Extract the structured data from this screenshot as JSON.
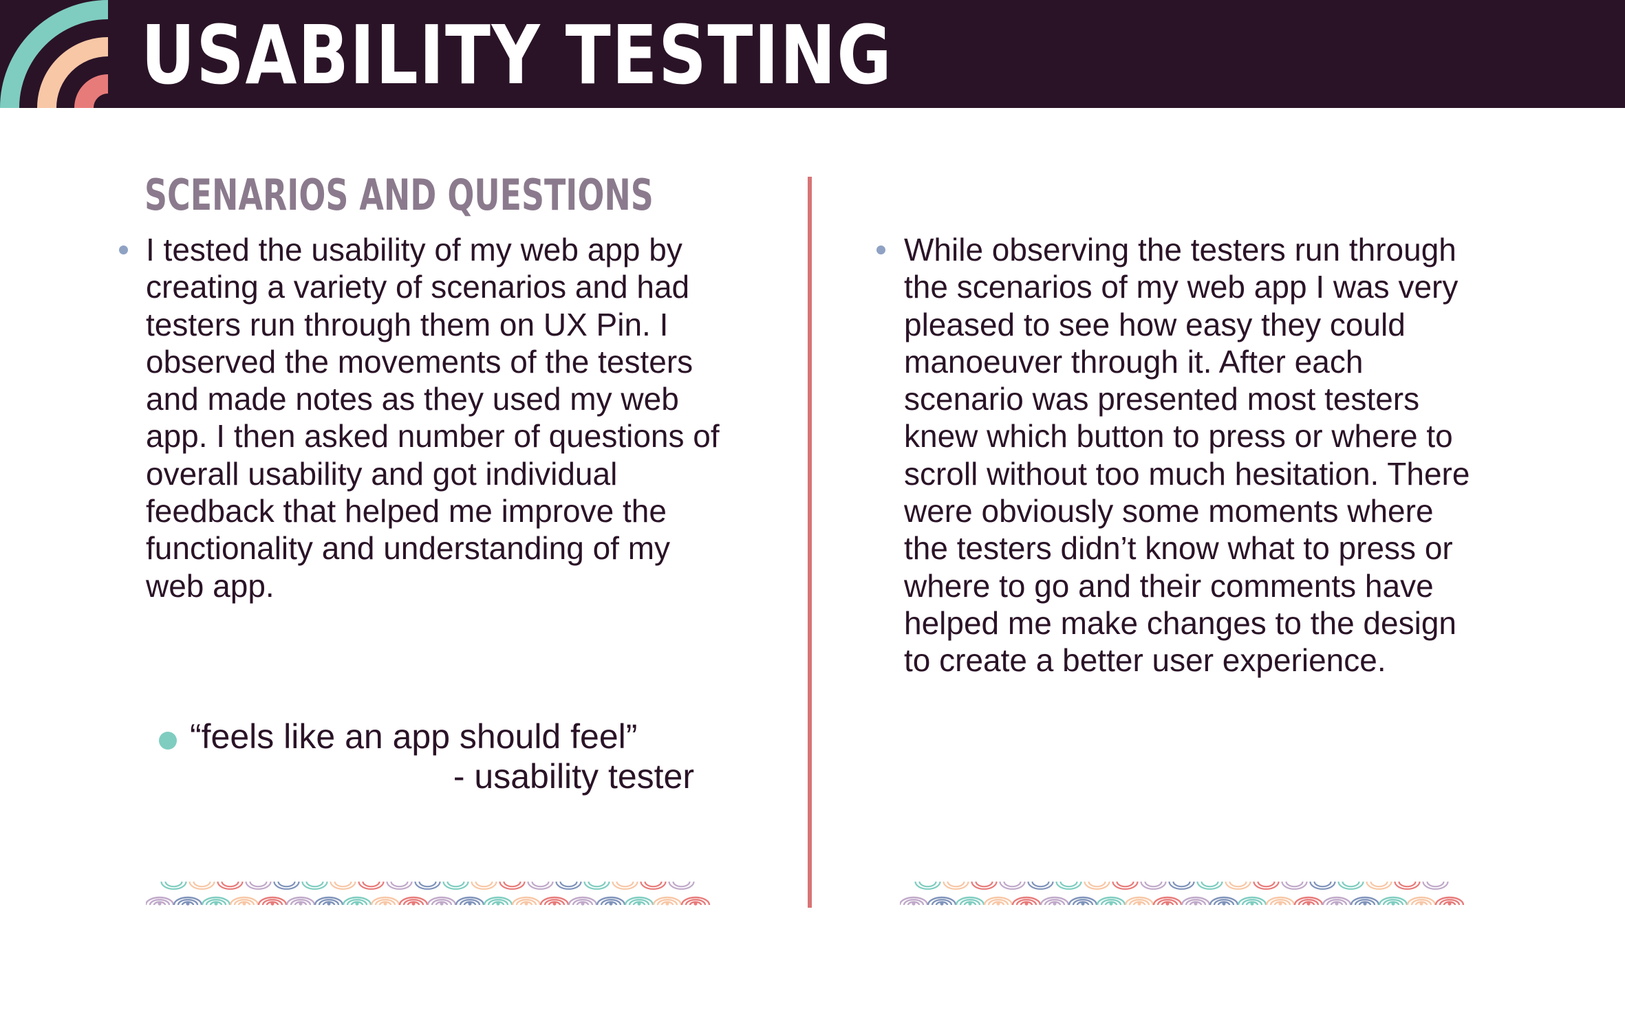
{
  "header": {
    "title": "USABILITY TESTING"
  },
  "section": {
    "heading": "SCENARIOS AND QUESTIONS"
  },
  "left_column": {
    "paragraph": "I tested the usability of my web app by creating a variety of scenarios and had testers run through them on UX Pin. I observed the movements of the testers and made notes as they used my web app. I then asked number of questions of overall usability and got individual feedback that helped me improve the functionality and understanding of my web app."
  },
  "quote": {
    "text": "“feels like an app should feel”",
    "attribution": "- usability tester"
  },
  "right_column": {
    "paragraph": "While observing the testers run through the scenarios of my web app I was very pleased to see how easy they could manoeuver through it. After each scenario was presented most testers knew which button to press or where to scroll without too much hesitation. There were obviously some moments where the testers didn’t know what to press or where to go and their comments have helped me make changes to the design to create a better user experience."
  },
  "colors": {
    "banner_background": "#2a1327",
    "heading": "#8b7a8d",
    "body_text": "#2a1327",
    "divider": "#d77475",
    "bullet": "#8fa2c4",
    "quote_bullet": "#7fcdc0",
    "arc_teal": "#7fcdc0",
    "arc_peach": "#f7c7a6",
    "arc_coral": "#e77b7a",
    "pattern": [
      "#c0a9c9",
      "#7f93ba",
      "#7fcdc0",
      "#f7c7a6",
      "#e77b7a"
    ]
  },
  "icons": {
    "logo": "concentric-arcs-logo",
    "pattern": "wave-scallop-pattern"
  }
}
